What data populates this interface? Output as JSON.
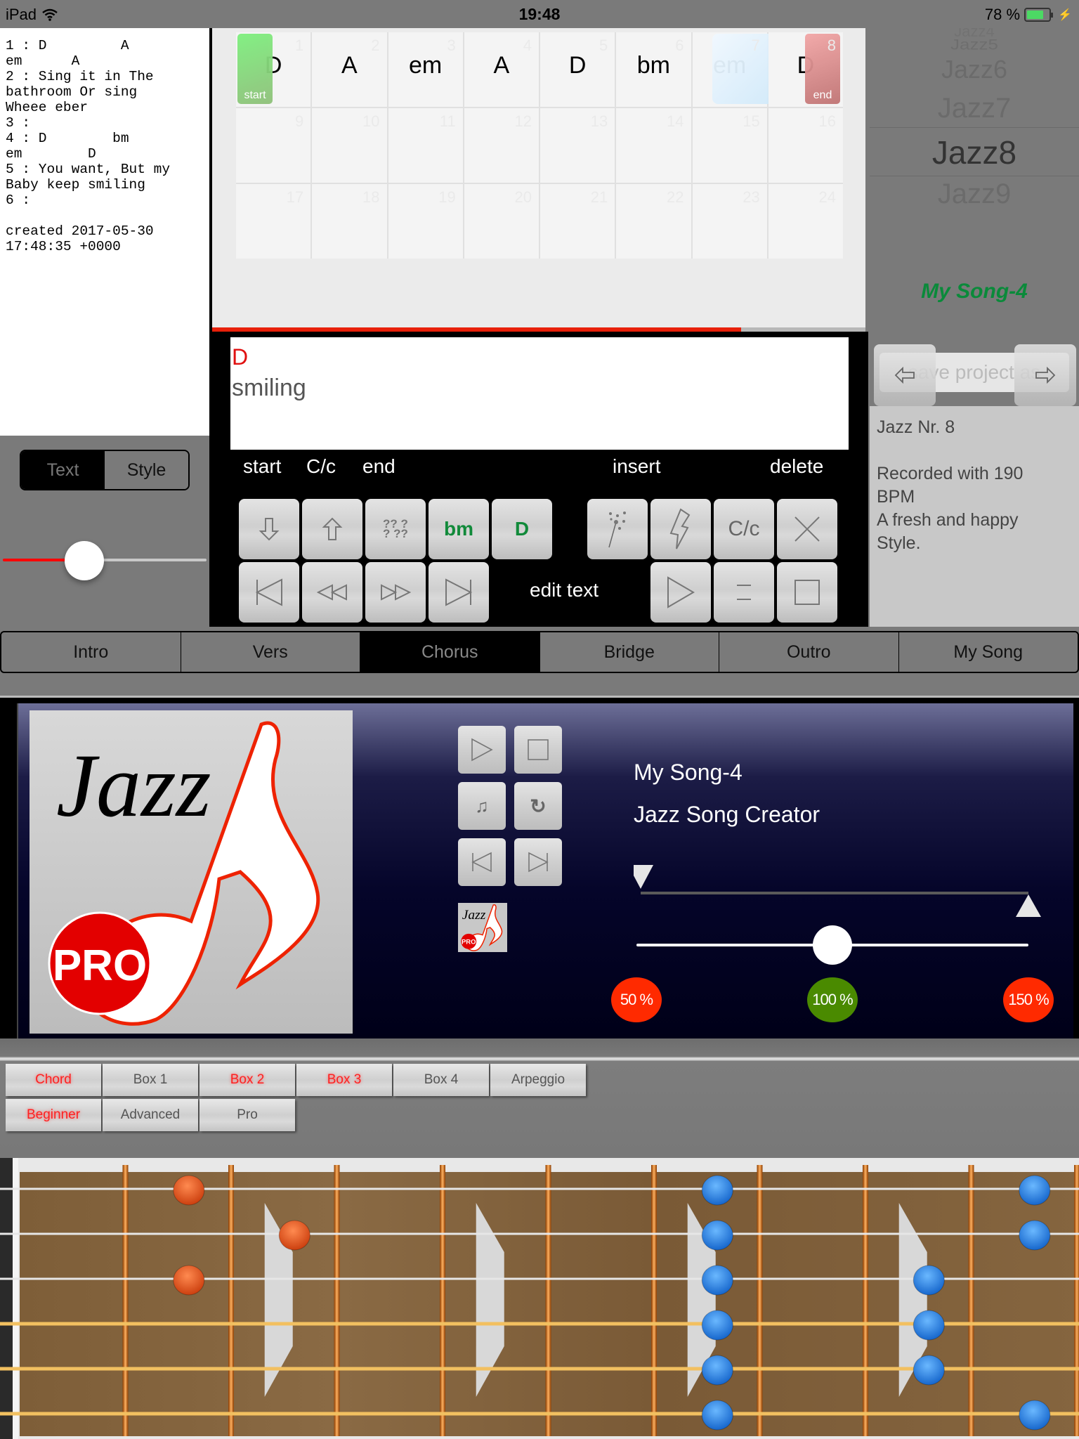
{
  "status_bar": {
    "device": "iPad",
    "time": "19:48",
    "battery": "78 %",
    "battery_level": 0.78
  },
  "lyrics": {
    "text": "1 : D         A\nem      A\n2 : Sing it in The\nbathroom Or sing\nWheee eber\n3 :\n4 : D        bm\nem        D\n5 : You want, But my\nBaby keep smiling\n6 :\n\ncreated 2017-05-30\n17:48:35 +0000"
  },
  "view_toggle": {
    "options": [
      "Text",
      "Style"
    ],
    "selected": "Text"
  },
  "left_slider": {
    "value": 0.4
  },
  "chord_grid": {
    "cells": [
      {
        "num": "1",
        "chord": "D"
      },
      {
        "num": "2",
        "chord": "A"
      },
      {
        "num": "3",
        "chord": "em"
      },
      {
        "num": "4",
        "chord": "A"
      },
      {
        "num": "5",
        "chord": "D"
      },
      {
        "num": "6",
        "chord": "bm"
      },
      {
        "num": "7",
        "chord": "em"
      },
      {
        "num": "8",
        "chord": "D"
      },
      {
        "num": "9",
        "chord": ""
      },
      {
        "num": "10",
        "chord": ""
      },
      {
        "num": "11",
        "chord": ""
      },
      {
        "num": "12",
        "chord": ""
      },
      {
        "num": "13",
        "chord": ""
      },
      {
        "num": "14",
        "chord": ""
      },
      {
        "num": "15",
        "chord": ""
      },
      {
        "num": "16",
        "chord": ""
      },
      {
        "num": "17",
        "chord": ""
      },
      {
        "num": "18",
        "chord": ""
      },
      {
        "num": "19",
        "chord": ""
      },
      {
        "num": "20",
        "chord": ""
      },
      {
        "num": "21",
        "chord": ""
      },
      {
        "num": "22",
        "chord": ""
      },
      {
        "num": "23",
        "chord": ""
      },
      {
        "num": "24",
        "chord": ""
      }
    ],
    "start_label": "start",
    "end_label": "end",
    "current_cell": 7
  },
  "playback_progress": 0.81,
  "current_line": {
    "chord": "D",
    "lyric": "smiling"
  },
  "editor": {
    "labels": {
      "start": "start",
      "case": "C/c",
      "end": "end",
      "insert": "insert",
      "delete": "delete",
      "edit_text": "edit text"
    },
    "chord_buttons": [
      "bm",
      "D"
    ],
    "case_button": "C/c"
  },
  "style_picker": {
    "items": [
      "Jazz4",
      "Jazz5",
      "Jazz6",
      "Jazz7",
      "Jazz8",
      "Jazz9"
    ],
    "selected": "Jazz8"
  },
  "project": {
    "name": "My Song-4",
    "save_placeholder": "save project as"
  },
  "description": "Jazz Nr. 8\n\nRecorded with 190\nBPM\nA fresh and happy\nStyle.",
  "section_tabs": [
    {
      "label": "Intro",
      "active": false
    },
    {
      "label": "Vers",
      "active": false
    },
    {
      "label": "Chorus",
      "active": true
    },
    {
      "label": "Bridge",
      "active": false
    },
    {
      "label": "Outro",
      "active": false
    },
    {
      "label": "My Song",
      "active": false
    }
  ],
  "player": {
    "logo_text": "Jazz",
    "logo_badge": "PRO",
    "title": "My Song-4",
    "subtitle": "Jazz Song Creator",
    "loop_start": 0.0,
    "loop_end": 1.0,
    "tempo_percent": 100,
    "tempo_min": 50,
    "tempo_max": 150,
    "tempo_marks": [
      {
        "label": "50 %",
        "value": 50,
        "color": "#ff2a00"
      },
      {
        "label": "100 %",
        "value": 100,
        "color": "#4a8a00"
      },
      {
        "label": "150 %",
        "value": 150,
        "color": "#ff2a00"
      }
    ]
  },
  "style_buttons": {
    "row1": [
      {
        "label": "Chord",
        "on": true
      },
      {
        "label": "Box 1",
        "on": false
      },
      {
        "label": "Box 2",
        "on": true
      },
      {
        "label": "Box 3",
        "on": true
      },
      {
        "label": "Box 4",
        "on": false
      },
      {
        "label": "Arpeggio",
        "on": false
      }
    ],
    "row2": [
      {
        "label": "Beginner",
        "on": true
      },
      {
        "label": "Advanced",
        "on": false
      },
      {
        "label": "Pro",
        "on": false
      }
    ]
  },
  "fretboard": {
    "strings": 6,
    "frets_visible": 10,
    "inlay_frets": [
      3,
      5,
      7,
      9
    ],
    "orange_dots": [
      {
        "string": 1,
        "fret": 2
      },
      {
        "string": 2,
        "fret": 3
      },
      {
        "string": 3,
        "fret": 2
      }
    ],
    "blue_dots": [
      {
        "string": 1,
        "fret": 7
      },
      {
        "string": 2,
        "fret": 7
      },
      {
        "string": 3,
        "fret": 7
      },
      {
        "string": 4,
        "fret": 7
      },
      {
        "string": 5,
        "fret": 7
      },
      {
        "string": 6,
        "fret": 7
      },
      {
        "string": 3,
        "fret": 9
      },
      {
        "string": 4,
        "fret": 9
      },
      {
        "string": 5,
        "fret": 9
      },
      {
        "string": 1,
        "fret": 10
      },
      {
        "string": 2,
        "fret": 10
      },
      {
        "string": 6,
        "fret": 10
      }
    ],
    "colors": {
      "orange": "#e0501a",
      "blue": "#2a86e0"
    }
  }
}
